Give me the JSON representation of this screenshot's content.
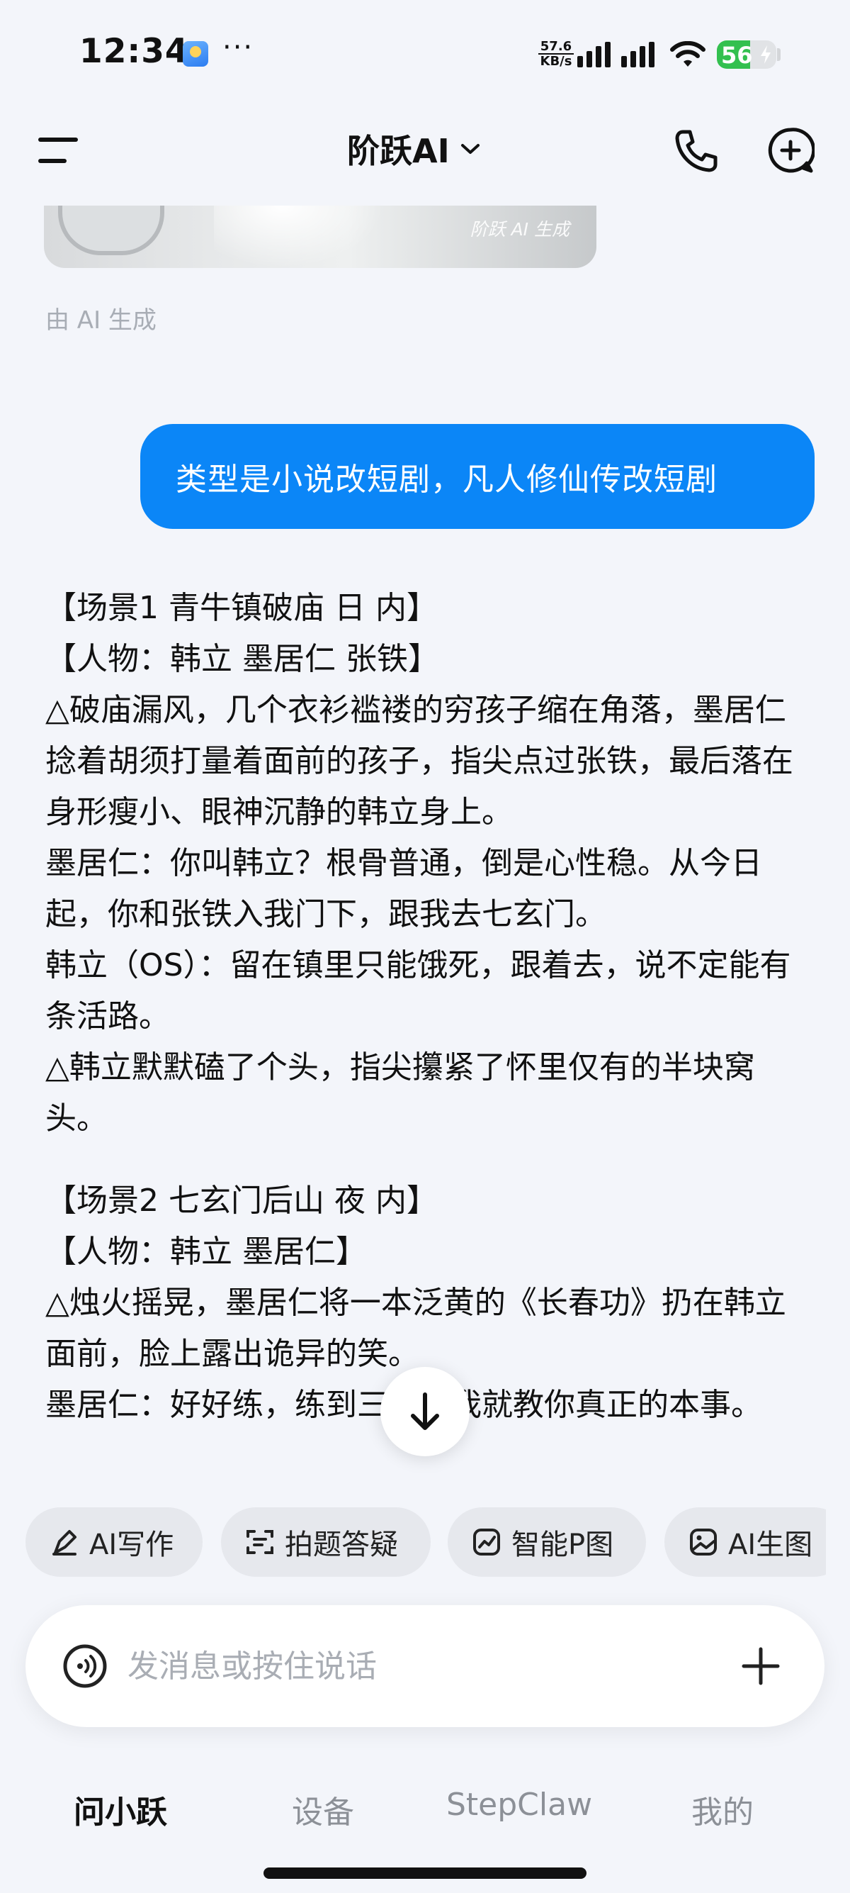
{
  "status_bar": {
    "time": "12:34",
    "more": "···",
    "net_speed_value": "57.6",
    "net_speed_unit": "KB/s",
    "battery": "56"
  },
  "header": {
    "title": "阶跃AI"
  },
  "chat": {
    "image_watermark": "阶跃 AI 生成",
    "ai_generated_note": "由 AI 生成",
    "user_message": "类型是小说改短剧，凡人修仙传改短剧",
    "scenes": [
      {
        "heading": "【场景1 青牛镇破庙 日 内】",
        "characters": "【人物：韩立 墨居仁 张铁】",
        "lines": [
          "△破庙漏风，几个衣衫褴褛的穷孩子缩在角落，墨居仁捻着胡须打量着面前的孩子，指尖点过张铁，最后落在身形瘦小、眼神沉静的韩立身上。",
          "墨居仁：你叫韩立？根骨普通，倒是心性稳。从今日起，你和张铁入我门下，跟我去七玄门。",
          "韩立（OS）：留在镇里只能饿死，跟着去，说不定能有条活路。",
          "△韩立默默磕了个头，指尖攥紧了怀里仅有的半块窝头。"
        ]
      },
      {
        "heading": "【场景2 七玄门后山 夜 内】",
        "characters": "【人物：韩立 墨居仁】",
        "lines": [
          "△烛火摇晃，墨居仁将一本泛黄的《长春功》扔在韩立面前，脸上露出诡异的笑。",
          "墨居仁：好好练，练到三层，我就教你真正的本事。"
        ]
      }
    ]
  },
  "quick_actions": [
    {
      "label": "AI写作",
      "icon": "pen-icon"
    },
    {
      "label": "拍题答疑",
      "icon": "scan-icon"
    },
    {
      "label": "智能P图",
      "icon": "photo-edit-icon"
    },
    {
      "label": "AI生图",
      "icon": "image-icon"
    }
  ],
  "input": {
    "placeholder": "发消息或按住说话"
  },
  "bottom_nav": {
    "tabs": [
      "问小跃",
      "设备",
      "StepClaw",
      "我的"
    ],
    "active": "问小跃"
  },
  "colors": {
    "accent": "#0b86f7",
    "background": "#f3f5fa",
    "chip": "#e6e8ed",
    "battery": "#33c04f"
  }
}
